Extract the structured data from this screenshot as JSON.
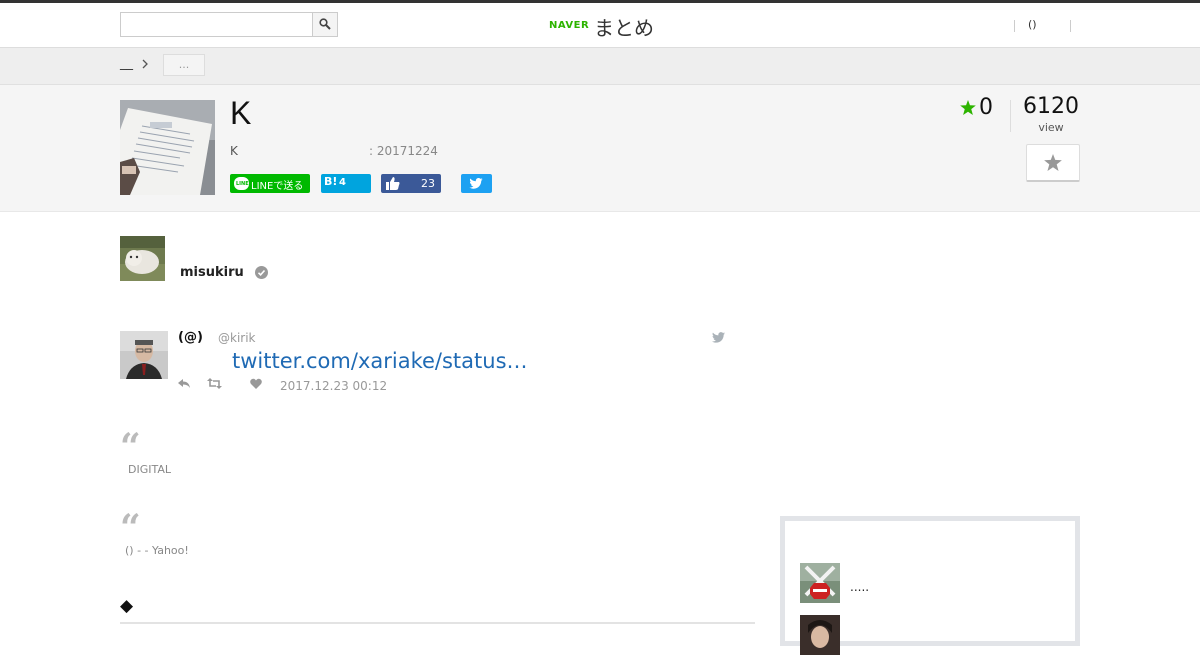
{
  "header": {
    "search": {
      "value": "",
      "placeholder": ""
    },
    "logo": {
      "brand": "NAVER",
      "service": "まとめ"
    },
    "user_link": "()"
  },
  "breadcrumb": {
    "home": "__",
    "tag": "..."
  },
  "matome": {
    "title": "K",
    "description": "K",
    "updated": ": 20171224",
    "favorites": "0",
    "views": "6120",
    "views_label": "view"
  },
  "share": {
    "line_label": "LINEで送る",
    "hatena_label": "B!",
    "hatena_count": "4",
    "facebook_count": "23"
  },
  "author": {
    "name": "misukiru"
  },
  "tweet": {
    "name": "(@)",
    "handle": "@kirik",
    "link_text": "twitter.com/xariake/status…",
    "time": "2017.12.23 00:12"
  },
  "quotes": [
    {
      "mark": "“",
      "source": "DIGITAL"
    },
    {
      "mark": "“",
      "source": "() -  - Yahoo!"
    }
  ],
  "section_heading": "◆",
  "sidebar": {
    "items": [
      {
        "text": "....."
      },
      {
        "text": ""
      }
    ]
  },
  "colors": {
    "naver_green": "#2db400",
    "line_green": "#00b900",
    "hatena_blue": "#00a4de",
    "facebook_blue": "#3b5998",
    "twitter_blue": "#1da1f2",
    "link_blue": "#1f6ab4",
    "favorite_star": "#2db400"
  }
}
